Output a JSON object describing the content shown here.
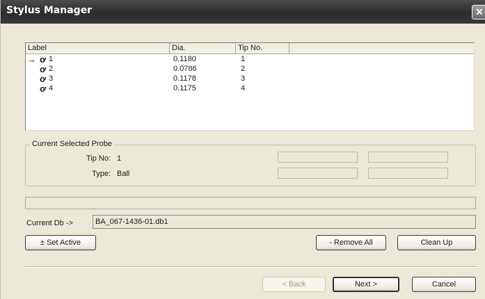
{
  "window": {
    "title": "Stylus Manager",
    "close_glyph": "✕"
  },
  "list": {
    "columns": [
      "Label",
      "Dia.",
      "Tip No."
    ],
    "rows": [
      {
        "label": "1",
        "dia": "0.1180",
        "tip": "1",
        "active": true
      },
      {
        "label": "2",
        "dia": "0.0786",
        "tip": "2",
        "active": false
      },
      {
        "label": "3",
        "dia": "0.1178",
        "tip": "3",
        "active": false
      },
      {
        "label": "4",
        "dia": "0.1175",
        "tip": "4",
        "active": false
      }
    ],
    "active_marker_glyph": "→",
    "probe_icon_glyph": "ơ"
  },
  "current_probe": {
    "legend": "Current Selected Probe",
    "tip_label": "Tip No:",
    "tip_value": "1",
    "type_label": "Type:",
    "type_value": "Ball"
  },
  "database": {
    "label": "Current Db ->",
    "value": "BA_067-1436-01.db1"
  },
  "buttons": {
    "set_active": "± Set Active",
    "remove_all": "- Remove All",
    "clean_up": "Clean Up",
    "back": "< Back",
    "next": "Next >",
    "cancel": "Cancel"
  }
}
